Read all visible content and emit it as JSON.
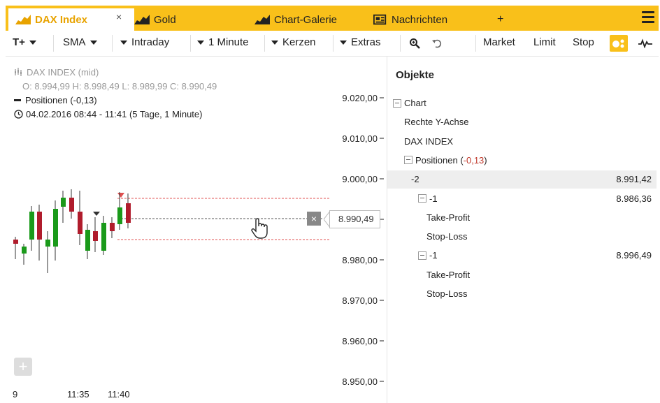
{
  "tabs": [
    {
      "label": "DAX Index",
      "active": true
    },
    {
      "label": "Gold",
      "active": false
    },
    {
      "label": "Chart-Galerie",
      "active": false
    },
    {
      "label": "Nachrichten",
      "active": false
    }
  ],
  "tab_add": "+",
  "tab_close": "×",
  "toolbar": {
    "drawing_tool": "T+",
    "indicator": "SMA",
    "timeframe": "Intraday",
    "interval": "1 Minute",
    "chart_type": "Kerzen",
    "extras": "Extras",
    "market": "Market",
    "limit": "Limit",
    "stop": "Stop"
  },
  "chart": {
    "instrument": "DAX INDEX (mid)",
    "ohlc": "O: 8.994,99  H: 8.998,49  L: 8.989,99  C: 8.990,49",
    "positions": "Positionen (-0,13)",
    "period": "04.02.2016 08:44 - 11:41 (5 Tage, 1 Minute)",
    "y_ticks": [
      "9.020,00",
      "9.010,00",
      "9.000,00",
      "8.990,00",
      "8.980,00",
      "8.970,00",
      "8.960,00",
      "8.950,00"
    ],
    "x_ticks": [
      "9",
      "11:35",
      "11:40"
    ],
    "last_price": "8.990,49",
    "close_label": "×",
    "colors": {
      "up": "#1a9a1a",
      "down": "#b01c2c",
      "order_line": "#e05050",
      "accent": "#f9c01a"
    }
  },
  "objects_panel": {
    "title": "Objekte",
    "rows": [
      {
        "label": "Chart",
        "value": "",
        "indent": 0,
        "box": true
      },
      {
        "label": "Rechte Y-Achse",
        "value": "",
        "indent": 1,
        "box": false
      },
      {
        "label": "DAX INDEX",
        "value": "",
        "indent": 1,
        "box": false
      },
      {
        "label": "Positionen (",
        "label_red": "-0,13",
        "label_end": ")",
        "value": "",
        "indent": 2,
        "box": true
      },
      {
        "label": "-2",
        "value": "8.991,42",
        "indent": 3,
        "box": false,
        "selected": true
      },
      {
        "label": "-1",
        "value": "8.986,36",
        "indent": 4,
        "box": true
      },
      {
        "label": "Take-Profit",
        "value": "",
        "indent": 5,
        "box": false
      },
      {
        "label": "Stop-Loss",
        "value": "",
        "indent": 5,
        "box": false
      },
      {
        "label": "-1",
        "value": "8.996,49",
        "indent": 4,
        "box": true
      },
      {
        "label": "Take-Profit",
        "value": "",
        "indent": 5,
        "box": false
      },
      {
        "label": "Stop-Loss",
        "value": "",
        "indent": 5,
        "box": false
      }
    ]
  }
}
